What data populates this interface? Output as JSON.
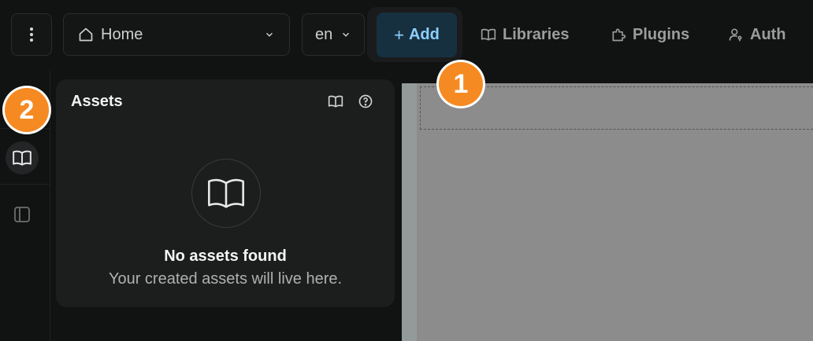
{
  "toolbar": {
    "menu_icon": "more-vertical-icon",
    "page_select": {
      "icon": "home-icon",
      "value": "Home"
    },
    "lang_select": {
      "value": "en"
    },
    "add_button": {
      "label": "Add",
      "icon": "plus-icon"
    },
    "nav": [
      {
        "label": "Libraries",
        "icon": "book-open-icon"
      },
      {
        "label": "Plugins",
        "icon": "plugin-icon"
      },
      {
        "label": "Auth",
        "icon": "user-key-icon"
      }
    ],
    "accent_color": "#8fd0ff"
  },
  "sidebar": {
    "items": [
      {
        "name": "assets",
        "icon": "book-open-icon",
        "active": true
      },
      {
        "name": "layers",
        "icon": "sidebar-panel-icon",
        "active": false
      }
    ]
  },
  "assets_panel": {
    "title": "Assets",
    "empty_state": {
      "icon": "book-open-icon",
      "title": "No assets found",
      "subtitle": "Your created assets will live here."
    }
  },
  "markers": [
    {
      "label": "1",
      "color": "#f58a22"
    },
    {
      "label": "2",
      "color": "#f58a22"
    }
  ]
}
